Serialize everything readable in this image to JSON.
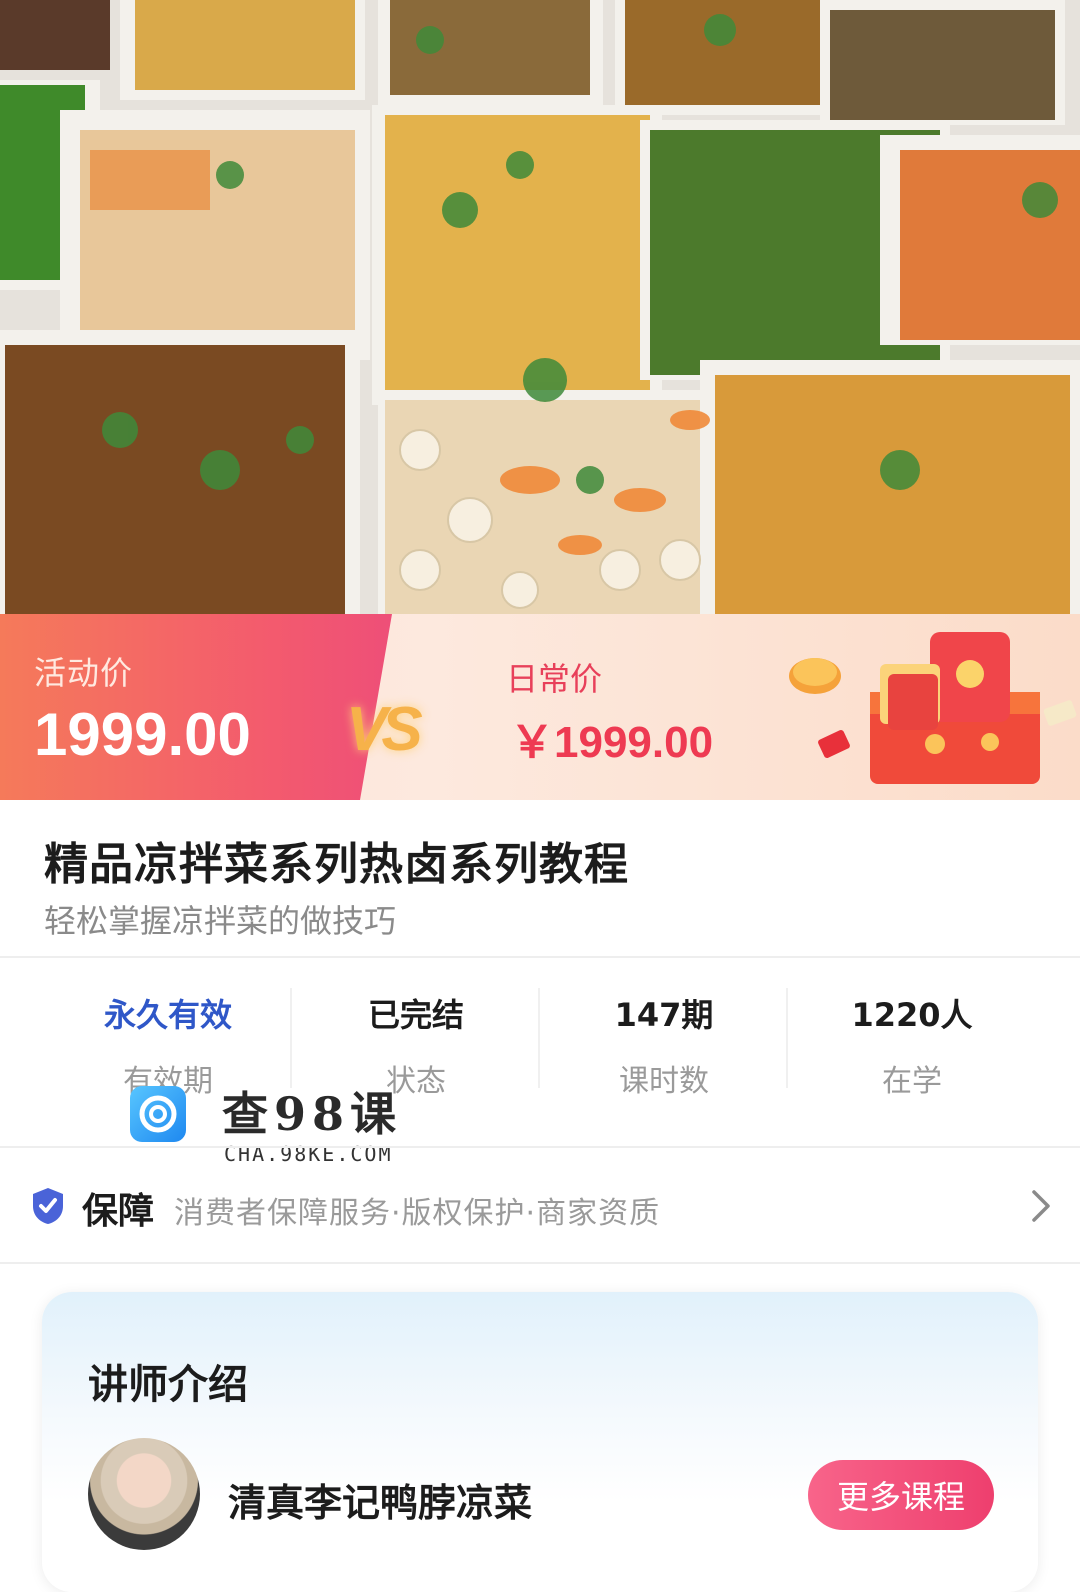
{
  "hero": {
    "image_alt": "assorted cold dishes in white trays",
    "icon": "food-photo"
  },
  "price": {
    "promo_label": "活动价",
    "promo_value": "1999.00",
    "vs_text": "VS",
    "daily_label": "日常价",
    "daily_value": "￥1999.00"
  },
  "course": {
    "title": "精品凉拌菜系列热卤系列教程",
    "subtitle": "轻松掌握凉拌菜的做技巧"
  },
  "stats": [
    {
      "value": "永久有效",
      "label": "有效期"
    },
    {
      "value": "已完结",
      "label": "状态"
    },
    {
      "value": "147期",
      "label": "课时数"
    },
    {
      "value": "1220人",
      "label": "在学"
    }
  ],
  "watermark": {
    "text": "查98课",
    "sub": "CHA.98KE.COM"
  },
  "guarantee": {
    "title": "保障",
    "items": "消费者保障服务·版权保护·商家资质",
    "icon": "shield-check-icon"
  },
  "lecturer": {
    "section_title": "讲师介绍",
    "name": "清真李记鸭脖凉菜",
    "more_button": "更多课程"
  },
  "colors": {
    "accent_red": "#ee3a52",
    "accent_blue": "#2f57c8",
    "promo_gradient_start": "#f57a5a"
  }
}
